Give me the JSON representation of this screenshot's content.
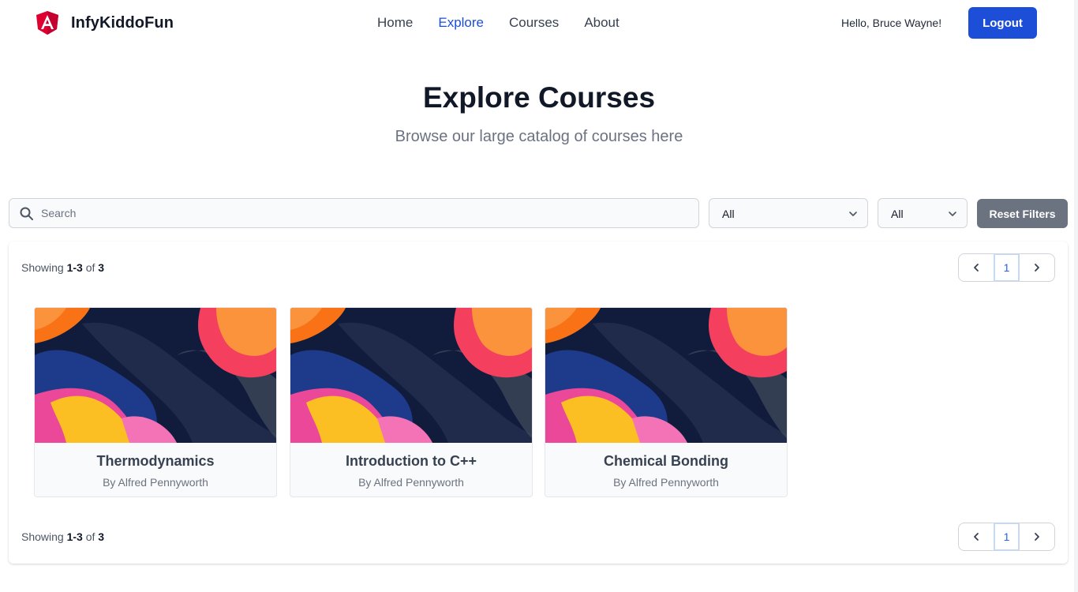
{
  "brand": {
    "name": "InfyKiddoFun",
    "logo_icon": "angular-logo-icon",
    "logo_color": "#dd0031"
  },
  "nav": {
    "items": [
      {
        "label": "Home",
        "active": false
      },
      {
        "label": "Explore",
        "active": true
      },
      {
        "label": "Courses",
        "active": false
      },
      {
        "label": "About",
        "active": false
      }
    ]
  },
  "user": {
    "greeting": "Hello, Bruce Wayne!",
    "logout_label": "Logout"
  },
  "hero": {
    "title": "Explore Courses",
    "subtitle": "Browse our large catalog of courses here"
  },
  "filters": {
    "search_placeholder": "Search",
    "search_value": "",
    "select_1_value": "All",
    "select_2_value": "All",
    "reset_label": "Reset Filters"
  },
  "results": {
    "showing_prefix": "Showing",
    "range": "1-3",
    "of_word": "of",
    "total": "3",
    "current_page": "1"
  },
  "courses": [
    {
      "title": "Thermodynamics",
      "author": "By Alfred Pennyworth"
    },
    {
      "title": "Introduction to C++",
      "author": "By Alfred Pennyworth"
    },
    {
      "title": "Chemical Bonding",
      "author": "By Alfred Pennyworth"
    }
  ],
  "colors": {
    "accent": "#1d4ed8",
    "reset_button": "#6b7280"
  }
}
